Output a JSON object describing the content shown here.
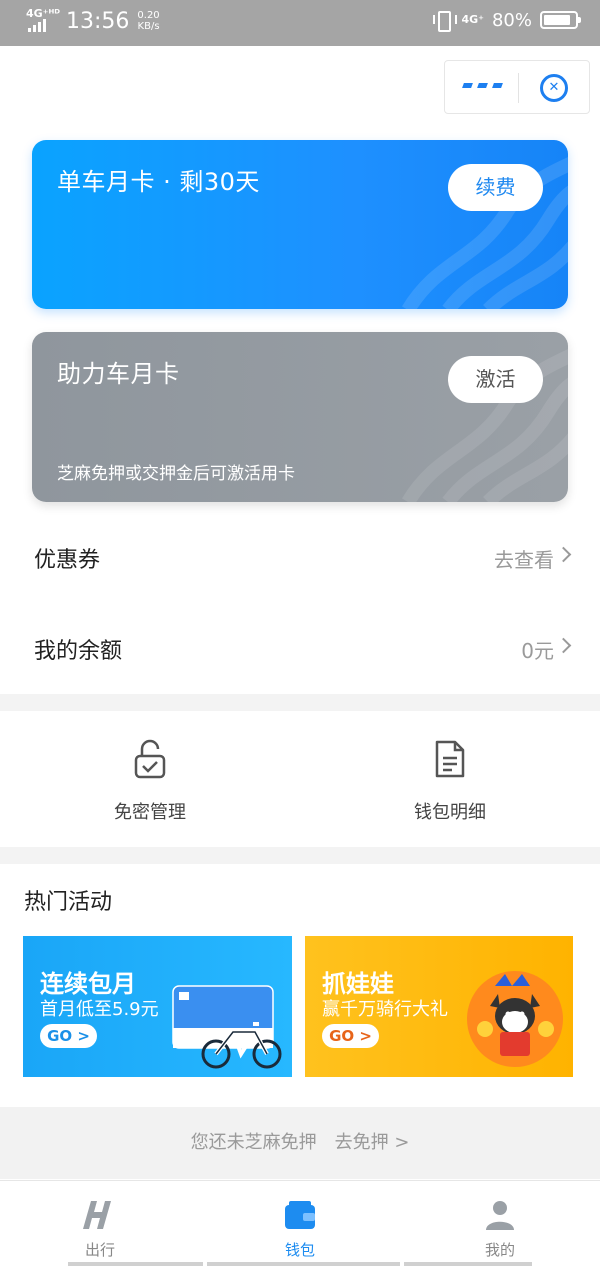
{
  "status_bar": {
    "network_left": "4G⁺ᴴᴰ",
    "time": "13:56",
    "speed_value": "0.20",
    "speed_unit": "KB/s",
    "network_right": "4G⁺",
    "battery_percent": "80%",
    "battery_level": 0.8
  },
  "cards": [
    {
      "title": "单车月卡 · 剩30天",
      "button": "续费",
      "color": "#1e90ff"
    },
    {
      "title": "助力车月卡",
      "button": "激活",
      "note": "芝麻免押或交押金后可激活用卡",
      "color": "#989ea4"
    }
  ],
  "rows": [
    {
      "label": "优惠券",
      "value": "去查看"
    },
    {
      "label": "我的余额",
      "value": "0元"
    }
  ],
  "quick_actions": [
    {
      "label": "免密管理",
      "icon": "unlock-check-icon"
    },
    {
      "label": "钱包明细",
      "icon": "document-icon"
    }
  ],
  "hot_section": {
    "title": "热门活动",
    "banners": [
      {
        "title": "连续包月",
        "subtitle": "首月低至5.9元",
        "go": "GO >"
      },
      {
        "title": "抓娃娃",
        "subtitle": "赢千万骑行大礼",
        "go": "GO >"
      }
    ]
  },
  "tip": {
    "text": "您还未芝麻免押",
    "link": "去免押 >"
  },
  "tabbar": {
    "tabs": [
      {
        "label": "出行",
        "icon": "hello-logo-icon"
      },
      {
        "label": "钱包",
        "icon": "wallet-icon",
        "active": true
      },
      {
        "label": "我的",
        "icon": "person-icon"
      }
    ]
  },
  "colors": {
    "accent": "#1d8cf0",
    "orange": "#ffb300",
    "gray_card": "#989ea4"
  }
}
